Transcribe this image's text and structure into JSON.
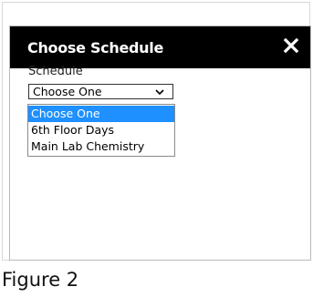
{
  "dialog": {
    "title": "Choose Schedule",
    "close_icon": "close-icon"
  },
  "form": {
    "schedule_label": "Schedule",
    "select_value": "Choose One",
    "options": [
      {
        "label": "Choose One",
        "selected": true
      },
      {
        "label": "6th Floor Days",
        "selected": false
      },
      {
        "label": "Main Lab Chemistry",
        "selected": false
      }
    ]
  },
  "caption": "Figure 2",
  "colors": {
    "header_bg": "#000000",
    "header_text": "#ffffff",
    "selected_option_bg": "#1e90ff"
  }
}
